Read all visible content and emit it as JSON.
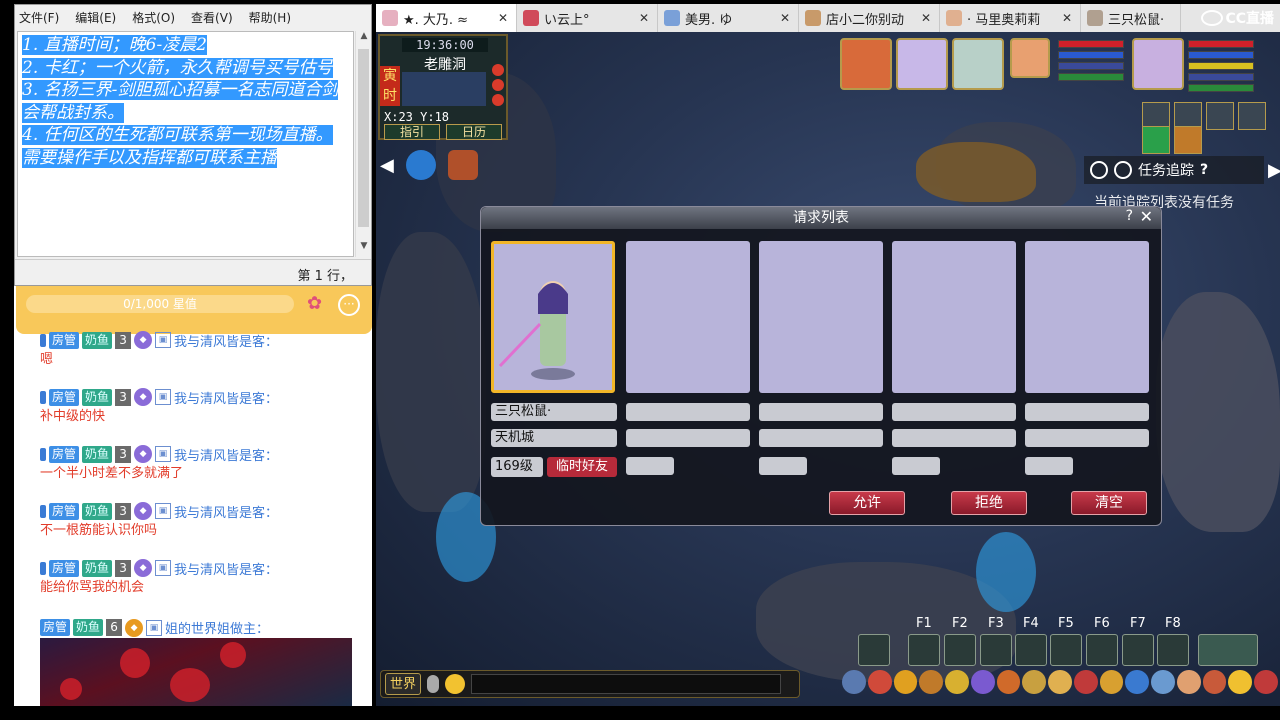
{
  "notepad": {
    "menu": [
      "文件(F)",
      "编辑(E)",
      "格式(O)",
      "查看(V)",
      "帮助(H)"
    ],
    "lines": [
      "1. 直播时间；晚6-凌晨2",
      "2. 卡红；一个火箭，永久帮调号买号估号",
      "3. 名扬三界-剑胆孤心招募一名志同道合剑会帮战封系。",
      "4. 任何区的生死都可联系第一现场直播。需要操作手以及指挥都可联系主播"
    ],
    "status": "第 1 行，"
  },
  "chat": {
    "star_progress": "0/1,000 星值",
    "messages": [
      {
        "admin": "房管",
        "fan": "奶鱼",
        "level": "3",
        "name": "我与清风皆是客：",
        "text": "嗯"
      },
      {
        "admin": "房管",
        "fan": "奶鱼",
        "level": "3",
        "name": "我与清风皆是客：",
        "text": "补中级的快"
      },
      {
        "admin": "房管",
        "fan": "奶鱼",
        "level": "3",
        "name": "我与清风皆是客：",
        "text": "一个半小时差不多就满了"
      },
      {
        "admin": "房管",
        "fan": "奶鱼",
        "level": "3",
        "name": "我与清风皆是客：",
        "text": "不一根筋能认识你吗"
      },
      {
        "admin": "房管",
        "fan": "奶鱼",
        "level": "3",
        "name": "我与清风皆是客：",
        "text": "能给你骂我的机会"
      }
    ],
    "last": {
      "admin": "房管",
      "fan": "奶鱼",
      "level": "6",
      "name": "姐的世界姐做主："
    }
  },
  "tabs": [
    {
      "title": "★. 大乃. ≈",
      "active": true
    },
    {
      "title": "い云上°",
      "active": false
    },
    {
      "title": "美男. ゆ",
      "active": false
    },
    {
      "title": "店小二你别动",
      "active": false
    },
    {
      "title": "· 马里奥莉莉",
      "active": false
    },
    {
      "title": "三只松鼠·",
      "active": false
    }
  ],
  "logo": "CC直播",
  "game": {
    "time": "19:36:00",
    "location": "老雕洞",
    "hour_label": "寅时",
    "coords": "X:23  Y:18",
    "btn_guide": "指引",
    "btn_calendar": "日历",
    "quest_title": "任务追踪",
    "quest_empty": "当前追踪列表没有任务",
    "dialog": {
      "title": "请求列表",
      "help": "?",
      "player_name": "三只松鼠·",
      "player_school": "天机城",
      "player_level": "169级",
      "tag": "临时好友",
      "btn_allow": "允许",
      "btn_reject": "拒绝",
      "btn_clear": "清空"
    },
    "fkeys": [
      "F1",
      "F2",
      "F3",
      "F4",
      "F5",
      "F6",
      "F7",
      "F8"
    ],
    "btn_world": "世界"
  }
}
